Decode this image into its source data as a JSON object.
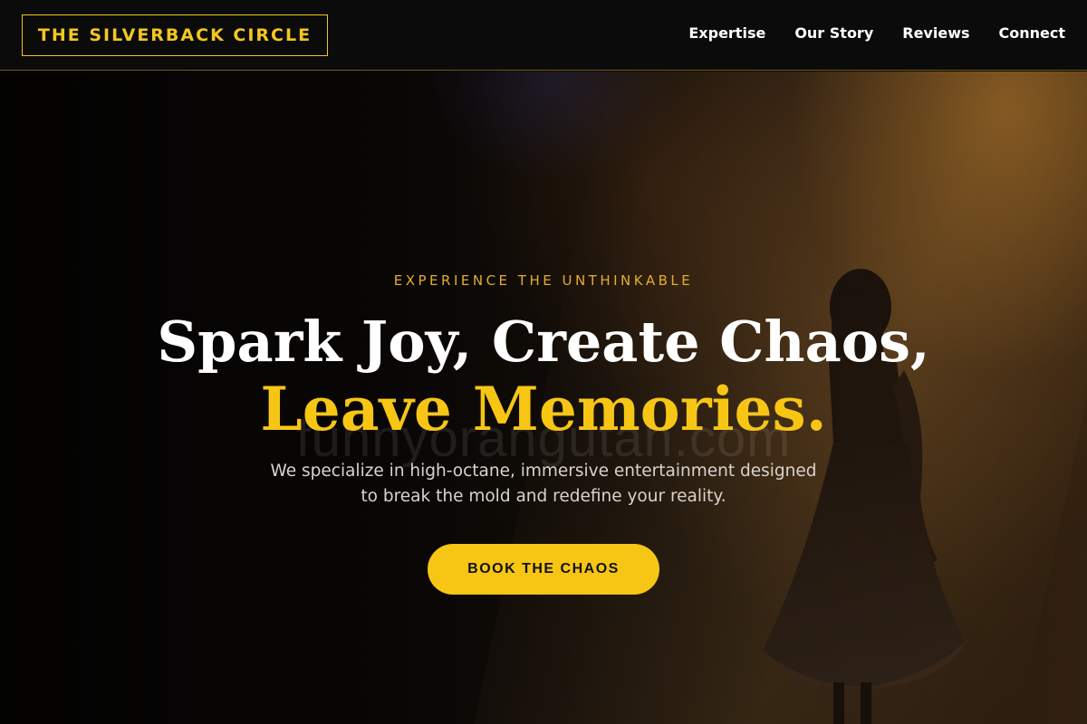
{
  "header": {
    "logo": "THE SILVERBACK CIRCLE",
    "nav": [
      "Expertise",
      "Our Story",
      "Reviews",
      "Connect"
    ]
  },
  "hero": {
    "eyebrow": "EXPERIENCE THE UNTHINKABLE",
    "headline_line1": "Spark Joy, Create Chaos,",
    "headline_line2": "Leave Memories.",
    "subtext_line1": "We specialize in high-octane, immersive entertainment designed",
    "subtext_line2": "to break the mold and redefine your reality.",
    "cta_label": "BOOK THE CHAOS",
    "background_image": "silhouette-of-dancer-on-stage"
  },
  "watermark": "funnyorangutan.com",
  "colors": {
    "accent": "#f7c615",
    "header_bg": "#0b0b0b",
    "eyebrow": "#e3ad2f"
  }
}
